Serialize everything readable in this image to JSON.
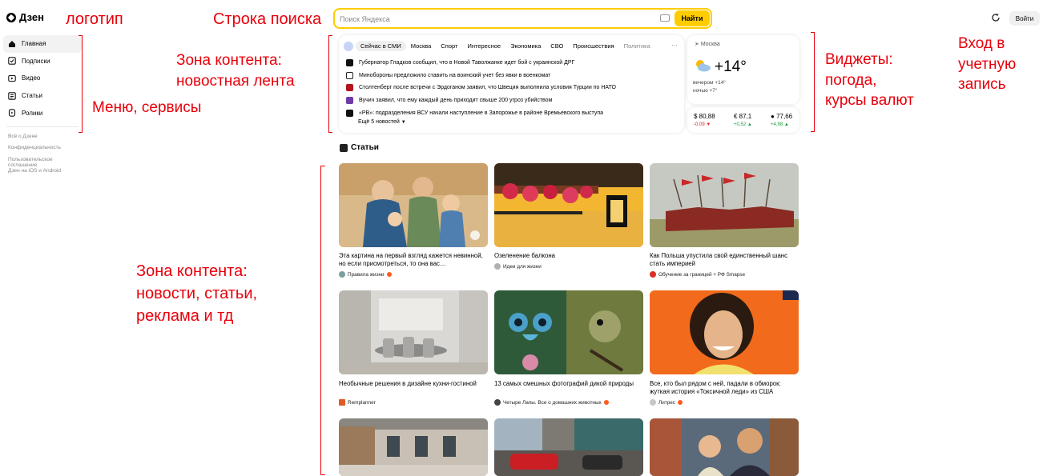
{
  "header": {
    "logo_text": "Дзен",
    "search_placeholder": "Поиск Яндекса",
    "search_button": "Найти",
    "login_button": "Войти"
  },
  "sidebar": {
    "items": [
      {
        "label": "Главная",
        "icon": "home-icon"
      },
      {
        "label": "Подписки",
        "icon": "subscriptions-icon"
      },
      {
        "label": "Видео",
        "icon": "video-icon"
      },
      {
        "label": "Статьи",
        "icon": "articles-icon"
      },
      {
        "label": "Ролики",
        "icon": "shorts-icon"
      }
    ],
    "links": [
      "Всё о Дзене",
      "Конфиденциальность",
      "Пользовательское соглашение",
      "Дзен на iOS и Android"
    ]
  },
  "news": {
    "tabs": [
      "Сейчас в СМИ",
      "Москва",
      "Спорт",
      "Интересное",
      "Экономика",
      "СВО",
      "Происшествия",
      "Политика"
    ],
    "items": [
      {
        "text": "Губернатор Гладков сообщил, что в Новой Таволжанке идет бой с украинской ДРГ",
        "source_color": "#111111"
      },
      {
        "text": "Минобороны предложило ставить на воинский учет без явки в военкомат",
        "source_color": "#ffffff"
      },
      {
        "text": "Столтенберг после встречи с Эрдоганом заявил, что Швеция выполнила условия Турции по НАТО",
        "source_color": "#b3151b"
      },
      {
        "text": "Вучич заявил, что ему каждый день приходит свыше 200 угроз убийством",
        "source_color": "#6d3ba8"
      },
      {
        "text": "«РВ»: подразделения ВСУ начали наступление в Запорожье в районе Времьевского выступа",
        "source_color": "#111111"
      }
    ],
    "more": "Ещё 5 новостей"
  },
  "weather": {
    "city": "Москва",
    "temp": "+14°",
    "evening": "вечером +14°",
    "night": "ночью +7°"
  },
  "currency": [
    {
      "value": "$ 80,88",
      "change": "-0,09",
      "dir": "down"
    },
    {
      "value": "€ 87,1",
      "change": "+0,52",
      "dir": "up"
    },
    {
      "value": "77,66",
      "change": "+4,98",
      "dir": "up"
    }
  ],
  "articles": {
    "title": "Статьи",
    "cards": [
      {
        "title": "Эта картина на первый взгляд кажется невинной, но если присмотреться, то она вас…",
        "source": "Правила жизни",
        "verified": true,
        "src_color": "#7a9fa0"
      },
      {
        "title": "Озеленение балкона",
        "source": "Идеи для жизни",
        "verified": false,
        "src_color": "#b0b0b0"
      },
      {
        "title": "Как Польша упустила свой единственный шанс стать империей",
        "source": "Обучение за границей + РФ Smapse",
        "verified": false,
        "src_color": "#d9302a"
      },
      {
        "title": "Необычные решения в дизайне кухни-гостиной",
        "source": "Remplanner",
        "verified": false,
        "src_color": "#e05a28"
      },
      {
        "title": "13 самых смешных фотографий дикой природы",
        "source": "Четыре Лапы. Все о домашних животных",
        "verified": true,
        "src_color": "#444444"
      },
      {
        "title": "Все, кто был рядом с ней, падали в обморок: жуткая история «Токсичной леди» из США",
        "source": "Литрес",
        "verified": true,
        "src_color": "#c7c7c7"
      }
    ]
  },
  "annotations": {
    "logo": "логотип",
    "search": "Строка поиска",
    "content_news_1": "Зона контента:",
    "content_news_2": "новостная лента",
    "menu": "Меню, сервисы",
    "widgets_1": "Виджеты:",
    "widgets_2": "погода,",
    "widgets_3": "курсы валют",
    "login_1": "Вход в",
    "login_2": "учетную",
    "login_3": "запись",
    "content_1": "Зона контента:",
    "content_2": "новости, статьи,",
    "content_3": "реклама и тд"
  },
  "colors": {
    "accent_yellow": "#ffcc00",
    "annotation_red": "#e8000b"
  }
}
